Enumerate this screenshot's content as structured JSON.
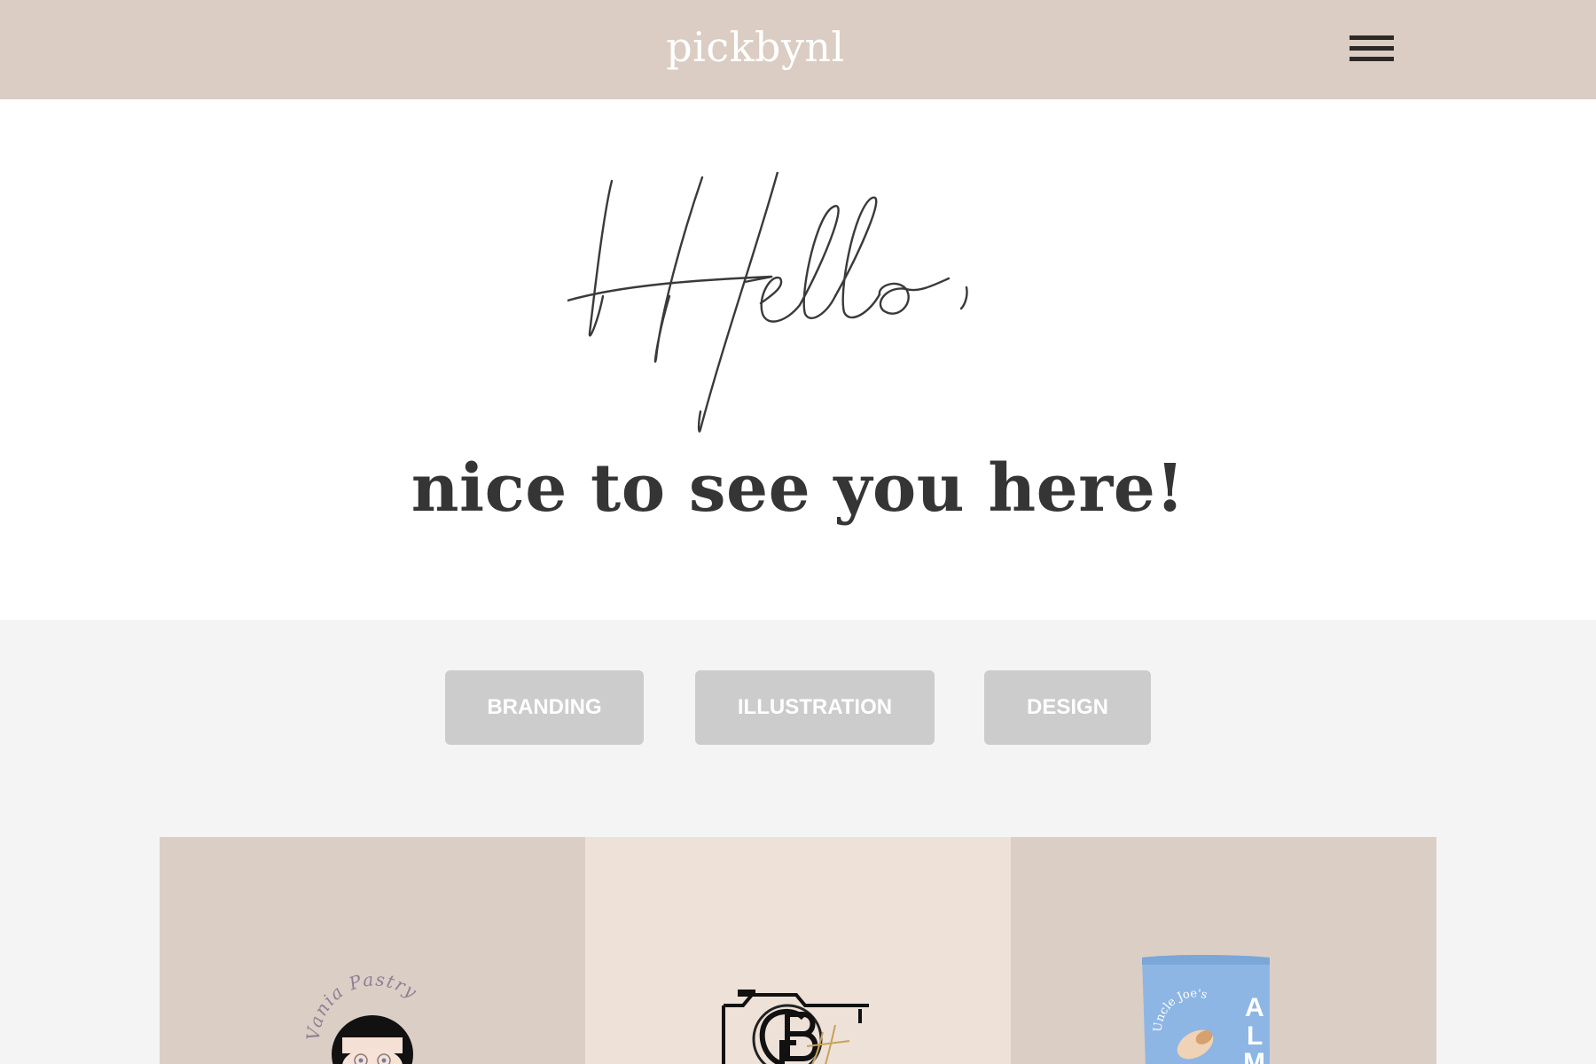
{
  "header": {
    "brand": "pickbynl",
    "menu_icon": "hamburger-icon"
  },
  "hero": {
    "greeting": "Hello,",
    "tagline": "nice to see you here!"
  },
  "filters": [
    {
      "label": "BRANDING"
    },
    {
      "label": "ILLUSTRATION"
    },
    {
      "label": "DESIGN"
    }
  ],
  "portfolio": [
    {
      "logo_text": "Vania Pastry"
    },
    {
      "logo_text": "GB"
    },
    {
      "logo_text": "Uncle Joe's",
      "package_text": "ALM"
    }
  ],
  "colors": {
    "header_bg": "#dbcdc3",
    "filter_bg": "#cccccc",
    "text_dark": "#353535"
  }
}
